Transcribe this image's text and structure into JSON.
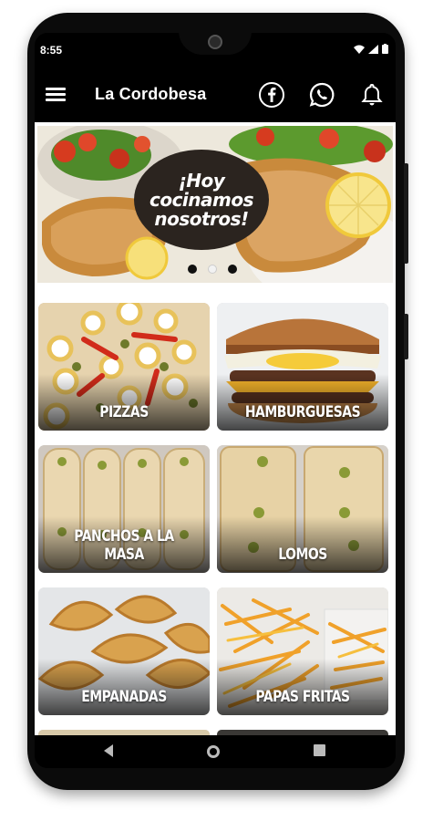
{
  "status_bar": {
    "time": "8:55"
  },
  "app_bar": {
    "title": "La Cordobesa"
  },
  "banner": {
    "text_line1": "¡Hoy",
    "text_line2": "cocinamos",
    "text_line3": "nosotros!",
    "active_slide": 1,
    "slide_count": 3
  },
  "categories": [
    {
      "label": "PIZZAS"
    },
    {
      "label": "HAMBURGUESAS"
    },
    {
      "label": "PANCHOS A LA MASA"
    },
    {
      "label": "LOMOS"
    },
    {
      "label": "EMPANADAS"
    },
    {
      "label": "PAPAS FRITAS"
    }
  ],
  "colors": {
    "app_bar": "#000000",
    "content_bg": "#ffffff",
    "label_text": "#ffffff"
  },
  "icons": {
    "menu": "menu-icon",
    "facebook": "facebook-icon",
    "whatsapp": "whatsapp-icon",
    "notifications": "bell-icon"
  }
}
